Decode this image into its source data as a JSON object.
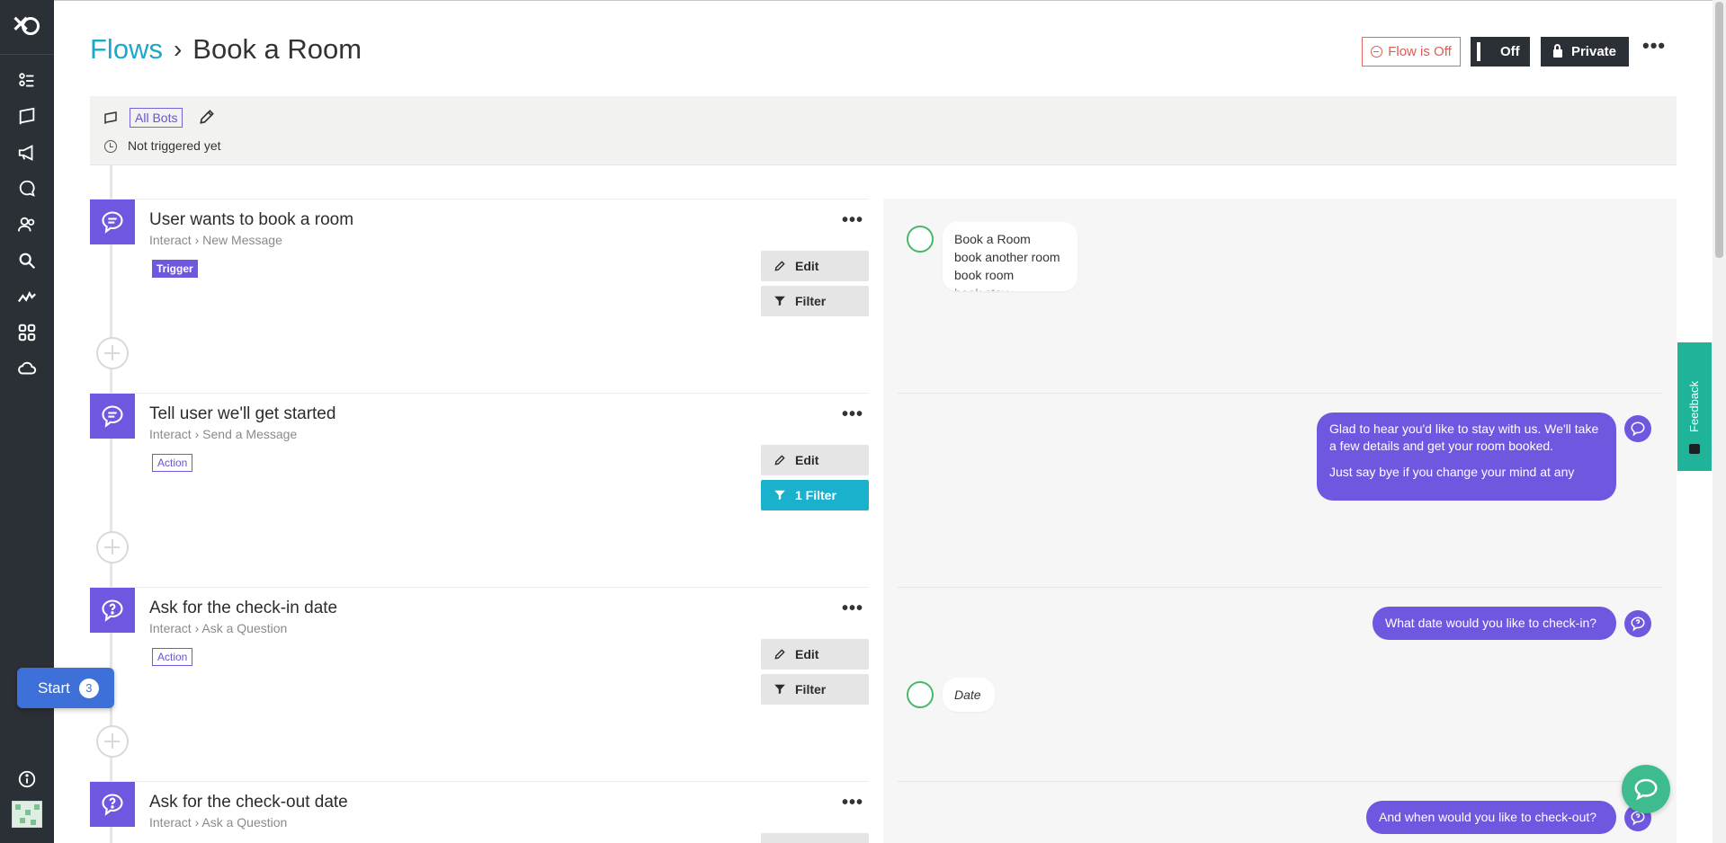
{
  "header": {
    "flows_link": "Flows",
    "separator": "›",
    "title": "Book a Room",
    "flow_status": "Flow is Off",
    "toggle_label": "Off",
    "privacy_label": "Private",
    "more": "•••"
  },
  "info": {
    "bots_tag": "All Bots",
    "trigger_status": "Not triggered yet"
  },
  "steps": [
    {
      "title": "User wants to book a room",
      "category": "Interact",
      "arrow": "›",
      "type": "New Message",
      "tag": "Trigger",
      "edit": "Edit",
      "filter": "Filter"
    },
    {
      "title": "Tell user we'll get started",
      "category": "Interact",
      "arrow": "›",
      "type": "Send a Message",
      "tag": "Action",
      "edit": "Edit",
      "filter": "1 Filter"
    },
    {
      "title": "Ask for the check-in date",
      "category": "Interact",
      "arrow": "›",
      "type": "Ask a Question",
      "tag": "Action",
      "edit": "Edit",
      "filter": "Filter"
    },
    {
      "title": "Ask for the check-out date",
      "category": "Interact",
      "arrow": "›",
      "type": "Ask a Question"
    }
  ],
  "preview": {
    "user_phrases": [
      "Book a Room",
      "book another room",
      "book room",
      "book stay"
    ],
    "bot_msg_1": "Glad to hear you'd like to stay with us. We'll take a few details and get your room booked.",
    "bot_msg_1b": "Just say bye if you change your mind at any",
    "bot_msg_2": "What date would you like to check-in?",
    "user_date": "Date",
    "bot_msg_3": "And when would you like to check-out?"
  },
  "start": {
    "label": "Start",
    "count": "3"
  },
  "feedback_label": "Feedback",
  "sidebar_icons": [
    "logo",
    "tasks-icon",
    "flag-icon",
    "megaphone-icon",
    "chat-icon",
    "users-icon",
    "search-icon",
    "analytics-icon",
    "apps-icon",
    "cloud-icon",
    "info-icon",
    "avatar"
  ],
  "colors": {
    "accent": "#7057e0",
    "link": "#1ca8c7",
    "filter_active": "#1ab1cc",
    "danger": "#e05b52",
    "sidebar": "#2b2f36"
  }
}
